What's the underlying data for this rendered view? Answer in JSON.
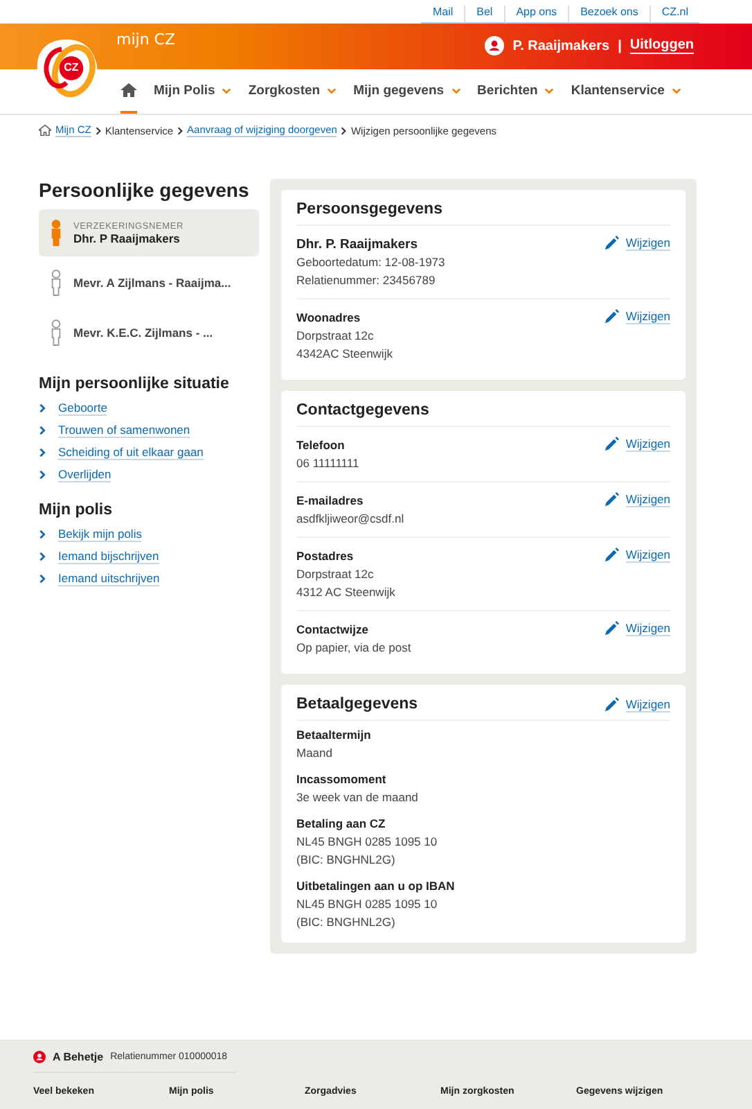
{
  "top_links": [
    "Mail",
    "Bel",
    "App ons",
    "Bezoek ons",
    "CZ.nl"
  ],
  "header": {
    "brand": "mijn CZ",
    "logo": "CZ",
    "user": "P. Raaijmakers",
    "separator": "|",
    "logout": "Uitloggen"
  },
  "nav": [
    {
      "kind": "home",
      "selected": true
    },
    {
      "kind": "menu",
      "label": "Mijn Polis",
      "selected": false
    },
    {
      "kind": "menu",
      "label": "Zorgkosten",
      "selected": false
    },
    {
      "kind": "menu",
      "label": "Mijn gegevens",
      "selected": false
    },
    {
      "kind": "menu",
      "label": "Berichten",
      "selected": false
    },
    {
      "kind": "menu",
      "label": "Klantenservice",
      "selected": false
    }
  ],
  "breadcrumb": [
    {
      "kind": "link",
      "label": "Mijn CZ"
    },
    {
      "kind": "text",
      "label": "Klantenservice"
    },
    {
      "kind": "link",
      "label": "Aanvraag of wijziging doorgeven"
    },
    {
      "kind": "text",
      "label": "Wijzigen persoonlijke gegevens"
    }
  ],
  "page_title": "Persoonlijke gegevens",
  "insured": [
    {
      "role": "VERZEKERINGSNEMER",
      "name": "Dhr. P Raaijmakers",
      "selected": true
    },
    {
      "name": "Mevr. A Zijlmans - Raaijma...",
      "selected": false
    },
    {
      "name": "Mevr. K.E.C. Zijlmans - ...",
      "selected": false
    }
  ],
  "sections": [
    {
      "title": "Mijn persoonlijke situatie",
      "links": [
        "Geboorte",
        "Trouwen of samenwonen",
        "Scheiding of uit elkaar gaan",
        "Overlijden"
      ]
    },
    {
      "title": "Mijn polis",
      "links": [
        "Bekijk mijn polis",
        "Iemand bijschrijven",
        "Iemand uitschrijven"
      ]
    }
  ],
  "cards": [
    {
      "title": "Persoonsgegevens",
      "rows": [
        {
          "kind": "name",
          "label": "Dhr. P. Raaijmakers",
          "lines": [
            "Geboortedatum: 12-08-1973",
            "Relatienummer: 23456789"
          ],
          "edit": "Wijzigen"
        },
        {
          "kind": "field",
          "label": "Woonadres",
          "lines": [
            "Dorpstraat 12c",
            "4342AC Steenwijk"
          ],
          "edit": "Wijzigen"
        }
      ]
    },
    {
      "title": "Contactgegevens",
      "rows": [
        {
          "kind": "field",
          "label": "Telefoon",
          "lines": [
            "06 11111111"
          ],
          "edit": "Wijzigen"
        },
        {
          "kind": "field",
          "label": "E-mailadres",
          "lines": [
            "asdfkljiweor@csdf.nl"
          ],
          "edit": "Wijzigen"
        },
        {
          "kind": "field",
          "label": "Postadres",
          "lines": [
            "Dorpstraat 12c",
            "4312 AC Steenwijk"
          ],
          "edit": "Wijzigen"
        },
        {
          "kind": "field",
          "label": "Contactwijze",
          "lines": [
            "Op papier, via de post"
          ],
          "edit": "Wijzigen"
        }
      ]
    },
    {
      "title": "Betaalgegevens",
      "edit": "Wijzigen",
      "rows": [
        {
          "kind": "plain",
          "label": "Betaaltermijn",
          "lines": [
            "Maand"
          ]
        },
        {
          "kind": "plain",
          "label": "Incassomoment",
          "lines": [
            "3e week van de maand"
          ]
        },
        {
          "kind": "plain",
          "label": "Betaling aan CZ",
          "lines": [
            "NL45 BNGH 0285 1095 10",
            "(BIC: BNGHNL2G)"
          ]
        },
        {
          "kind": "plain",
          "label": "Uitbetalingen aan u op IBAN",
          "lines": [
            "NL45 BNGH 0285 1095 10",
            "(BIC: BNGHNL2G)"
          ]
        }
      ]
    }
  ],
  "footer": {
    "user": "A Behetje",
    "relation": "Relatienummer 010000018",
    "columns": [
      "Veel bekeken",
      "Mijn polis",
      "Zorgadvies",
      "Mijn zorgkosten",
      "Gegevens wijzigen"
    ]
  }
}
